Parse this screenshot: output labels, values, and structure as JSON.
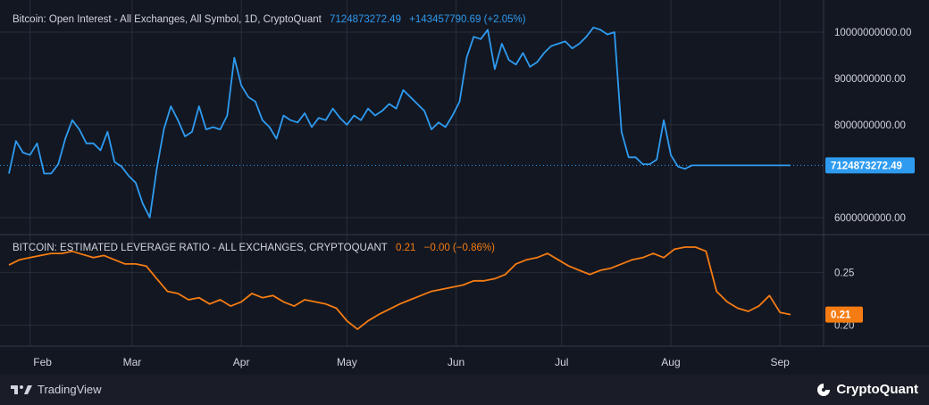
{
  "top_legend": {
    "title": "Bitcoin: Open Interest - All Exchanges, All Symbol, 1D, CryptoQuant",
    "value": "7124873272.49",
    "change": "+143457790.69 (+2.05%)"
  },
  "bottom_legend": {
    "title": "BITCOIN: ESTIMATED LEVERAGE RATIO - ALL EXCHANGES, CRYPTOQUANT",
    "value": "0.21",
    "change": "−0.00 (−0.86%)"
  },
  "footer": {
    "tradingview": "TradingView",
    "cryptoquant": "CryptoQuant"
  },
  "colors": {
    "open_interest": "#2e9bf0",
    "leverage": "#f57c12",
    "background": "#131722",
    "grid": "#2a2e39",
    "text": "#d1d4dc"
  },
  "chart_data": [
    {
      "type": "line",
      "title": "Bitcoin: Open Interest - All Exchanges, All Symbol, 1D, CryptoQuant",
      "ylim": [
        5650000000,
        10500000000
      ],
      "grid": true,
      "y_ticks": [
        "10000000000.00",
        "9000000000.00",
        "8000000000.00",
        "6000000000.00"
      ],
      "y_tick_values": [
        10000000000,
        9000000000,
        8000000000,
        6000000000
      ],
      "last_value_label": "7124873272.49",
      "last_value": 7124873272.49,
      "x_tick_labels": [
        "Feb",
        "Mar",
        "Apr",
        "May",
        "Jun",
        "Jul",
        "Aug",
        "Sep"
      ],
      "x_tick_dates": [
        "2024-02-01",
        "2024-03-01",
        "2024-04-01",
        "2024-05-01",
        "2024-06-01",
        "2024-07-01",
        "2024-08-01",
        "2024-09-01"
      ],
      "x": [
        "2024-01-26",
        "2024-01-28",
        "2024-01-30",
        "2024-02-01",
        "2024-02-03",
        "2024-02-05",
        "2024-02-07",
        "2024-02-09",
        "2024-02-11",
        "2024-02-13",
        "2024-02-15",
        "2024-02-17",
        "2024-02-19",
        "2024-02-21",
        "2024-02-23",
        "2024-02-25",
        "2024-02-27",
        "2024-02-29",
        "2024-03-02",
        "2024-03-04",
        "2024-03-06",
        "2024-03-08",
        "2024-03-10",
        "2024-03-12",
        "2024-03-14",
        "2024-03-16",
        "2024-03-18",
        "2024-03-20",
        "2024-03-22",
        "2024-03-24",
        "2024-03-26",
        "2024-03-28",
        "2024-03-30",
        "2024-04-01",
        "2024-04-03",
        "2024-04-05",
        "2024-04-07",
        "2024-04-09",
        "2024-04-11",
        "2024-04-13",
        "2024-04-15",
        "2024-04-17",
        "2024-04-19",
        "2024-04-21",
        "2024-04-23",
        "2024-04-25",
        "2024-04-27",
        "2024-04-29",
        "2024-05-01",
        "2024-05-03",
        "2024-05-05",
        "2024-05-07",
        "2024-05-09",
        "2024-05-11",
        "2024-05-13",
        "2024-05-15",
        "2024-05-17",
        "2024-05-19",
        "2024-05-21",
        "2024-05-23",
        "2024-05-25",
        "2024-05-27",
        "2024-05-29",
        "2024-05-31",
        "2024-06-02",
        "2024-06-04",
        "2024-06-06",
        "2024-06-08",
        "2024-06-10",
        "2024-06-12",
        "2024-06-14",
        "2024-06-16",
        "2024-06-18",
        "2024-06-20",
        "2024-06-22",
        "2024-06-24",
        "2024-06-26",
        "2024-06-28",
        "2024-06-30",
        "2024-07-02",
        "2024-07-04",
        "2024-07-06",
        "2024-07-08",
        "2024-07-10",
        "2024-07-12",
        "2024-07-14",
        "2024-07-16",
        "2024-07-18",
        "2024-07-20",
        "2024-07-22",
        "2024-07-24",
        "2024-07-26",
        "2024-07-28",
        "2024-07-30",
        "2024-08-01",
        "2024-08-03",
        "2024-08-05",
        "2024-08-07",
        "2024-08-09",
        "2024-08-11",
        "2024-08-13",
        "2024-08-15",
        "2024-08-17",
        "2024-08-19",
        "2024-08-21",
        "2024-08-23",
        "2024-08-25",
        "2024-08-27",
        "2024-08-29",
        "2024-08-31",
        "2024-09-02",
        "2024-09-04"
      ],
      "y": [
        6950000000,
        7650000000,
        7400000000,
        7350000000,
        7600000000,
        6950000000,
        6950000000,
        7150000000,
        7700000000,
        8100000000,
        7900000000,
        7600000000,
        7600000000,
        7450000000,
        7850000000,
        7200000000,
        7100000000,
        6900000000,
        6750000000,
        6300000000,
        6000000000,
        7050000000,
        7900000000,
        8400000000,
        8100000000,
        7750000000,
        7850000000,
        8400000000,
        7900000000,
        7950000000,
        7900000000,
        8200000000,
        9450000000,
        8850000000,
        8600000000,
        8500000000,
        8100000000,
        7950000000,
        7700000000,
        8200000000,
        8100000000,
        8050000000,
        8250000000,
        7950000000,
        8150000000,
        8100000000,
        8350000000,
        8150000000,
        8000000000,
        8200000000,
        8100000000,
        8350000000,
        8200000000,
        8300000000,
        8450000000,
        8350000000,
        8750000000,
        8600000000,
        8450000000,
        8300000000,
        7900000000,
        8050000000,
        7950000000,
        8200000000,
        8500000000,
        9450000000,
        9900000000,
        9850000000,
        10050000000,
        9200000000,
        9750000000,
        9400000000,
        9300000000,
        9550000000,
        9250000000,
        9350000000,
        9550000000,
        9700000000,
        9750000000,
        9800000000,
        9650000000,
        9750000000,
        9900000000,
        10100000000,
        10050000000,
        9950000000,
        10000000000,
        7850000000,
        7300000000,
        7300000000,
        7150000000,
        7150000000,
        7250000000,
        8100000000,
        7350000000,
        7100000000,
        7050000000,
        7124873272.49,
        7124873272.49,
        7124873272.49,
        7124873272.49,
        7124873272.49,
        7124873272.49,
        7124873272.49,
        7124873272.49,
        7124873272.49,
        7124873272.49,
        7124873272.49,
        7124873272.49,
        7124873272.49,
        7124873272.49,
        7124873272.49
      ]
    },
    {
      "type": "line",
      "title": "BITCOIN: ESTIMATED LEVERAGE RATIO - ALL EXCHANGES, CRYPTOQUANT",
      "ylim": [
        0.18,
        0.285
      ],
      "grid": true,
      "y_ticks": [
        "0.25",
        "0.20"
      ],
      "y_tick_values": [
        0.25,
        0.2
      ],
      "last_value_label": "0.21",
      "last_value": 0.21,
      "x": [
        "2024-01-26",
        "2024-01-29",
        "2024-02-01",
        "2024-02-04",
        "2024-02-07",
        "2024-02-10",
        "2024-02-13",
        "2024-02-16",
        "2024-02-19",
        "2024-02-22",
        "2024-02-25",
        "2024-02-28",
        "2024-03-02",
        "2024-03-05",
        "2024-03-08",
        "2024-03-11",
        "2024-03-14",
        "2024-03-17",
        "2024-03-20",
        "2024-03-23",
        "2024-03-26",
        "2024-03-29",
        "2024-04-01",
        "2024-04-04",
        "2024-04-07",
        "2024-04-10",
        "2024-04-13",
        "2024-04-16",
        "2024-04-19",
        "2024-04-22",
        "2024-04-25",
        "2024-04-28",
        "2024-05-01",
        "2024-05-04",
        "2024-05-07",
        "2024-05-10",
        "2024-05-13",
        "2024-05-16",
        "2024-05-19",
        "2024-05-22",
        "2024-05-25",
        "2024-05-28",
        "2024-05-31",
        "2024-06-03",
        "2024-06-06",
        "2024-06-09",
        "2024-06-12",
        "2024-06-15",
        "2024-06-18",
        "2024-06-21",
        "2024-06-24",
        "2024-06-27",
        "2024-06-30",
        "2024-07-03",
        "2024-07-06",
        "2024-07-09",
        "2024-07-12",
        "2024-07-15",
        "2024-07-18",
        "2024-07-21",
        "2024-07-24",
        "2024-07-27",
        "2024-07-30",
        "2024-08-02",
        "2024-08-05",
        "2024-08-08",
        "2024-08-11",
        "2024-08-14",
        "2024-08-17",
        "2024-08-20",
        "2024-08-23",
        "2024-08-26",
        "2024-08-29",
        "2024-09-01",
        "2024-09-04"
      ],
      "y": [
        0.257,
        0.262,
        0.264,
        0.266,
        0.268,
        0.268,
        0.27,
        0.267,
        0.264,
        0.266,
        0.262,
        0.258,
        0.258,
        0.256,
        0.244,
        0.232,
        0.23,
        0.224,
        0.226,
        0.22,
        0.224,
        0.218,
        0.222,
        0.23,
        0.226,
        0.228,
        0.222,
        0.218,
        0.224,
        0.222,
        0.22,
        0.216,
        0.204,
        0.196,
        0.204,
        0.21,
        0.215,
        0.22,
        0.224,
        0.228,
        0.232,
        0.234,
        0.236,
        0.238,
        0.242,
        0.242,
        0.244,
        0.248,
        0.258,
        0.262,
        0.264,
        0.268,
        0.262,
        0.256,
        0.252,
        0.248,
        0.252,
        0.254,
        0.258,
        0.262,
        0.264,
        0.268,
        0.264,
        0.272,
        0.274,
        0.274,
        0.27,
        0.232,
        0.222,
        0.216,
        0.213,
        0.218,
        0.228,
        0.212,
        0.21
      ]
    }
  ]
}
